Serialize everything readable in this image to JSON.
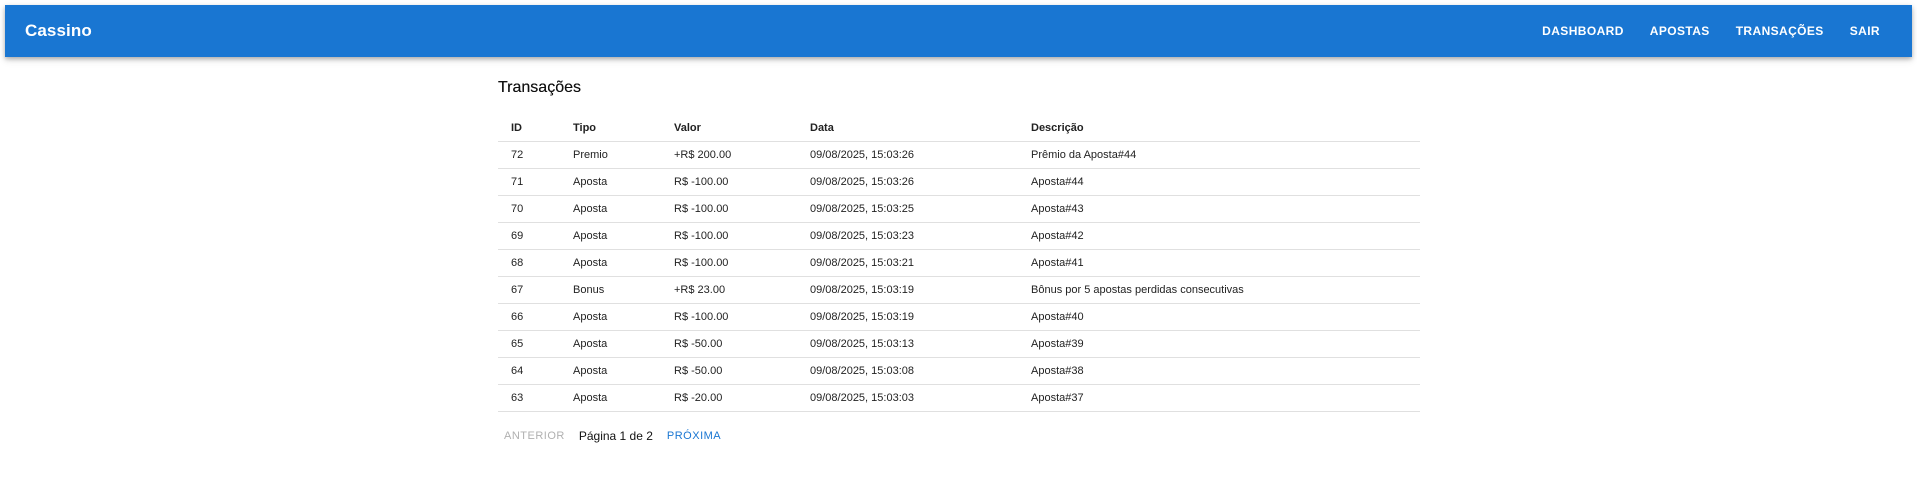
{
  "header": {
    "brand": "Cassino",
    "nav": [
      {
        "label": "DASHBOARD"
      },
      {
        "label": "APOSTAS"
      },
      {
        "label": "TRANSAÇÕES"
      },
      {
        "label": "SAIR"
      }
    ]
  },
  "page": {
    "title": "Transações"
  },
  "table": {
    "columns": [
      "ID",
      "Tipo",
      "Valor",
      "Data",
      "Descrição"
    ],
    "rows": [
      {
        "id": "72",
        "tipo": "Premio",
        "valor": "+R$ 200.00",
        "sign": "positive",
        "data": "09/08/2025, 15:03:26",
        "descricao": "Prêmio da Aposta#44"
      },
      {
        "id": "71",
        "tipo": "Aposta",
        "valor": "R$ -100.00",
        "sign": "negative",
        "data": "09/08/2025, 15:03:26",
        "descricao": "Aposta#44"
      },
      {
        "id": "70",
        "tipo": "Aposta",
        "valor": "R$ -100.00",
        "sign": "negative",
        "data": "09/08/2025, 15:03:25",
        "descricao": "Aposta#43"
      },
      {
        "id": "69",
        "tipo": "Aposta",
        "valor": "R$ -100.00",
        "sign": "negative",
        "data": "09/08/2025, 15:03:23",
        "descricao": "Aposta#42"
      },
      {
        "id": "68",
        "tipo": "Aposta",
        "valor": "R$ -100.00",
        "sign": "negative",
        "data": "09/08/2025, 15:03:21",
        "descricao": "Aposta#41"
      },
      {
        "id": "67",
        "tipo": "Bonus",
        "valor": "+R$ 23.00",
        "sign": "positive",
        "data": "09/08/2025, 15:03:19",
        "descricao": "Bônus por 5 apostas perdidas consecutivas"
      },
      {
        "id": "66",
        "tipo": "Aposta",
        "valor": "R$ -100.00",
        "sign": "negative",
        "data": "09/08/2025, 15:03:19",
        "descricao": "Aposta#40"
      },
      {
        "id": "65",
        "tipo": "Aposta",
        "valor": "R$ -50.00",
        "sign": "negative",
        "data": "09/08/2025, 15:03:13",
        "descricao": "Aposta#39"
      },
      {
        "id": "64",
        "tipo": "Aposta",
        "valor": "R$ -50.00",
        "sign": "negative",
        "data": "09/08/2025, 15:03:08",
        "descricao": "Aposta#38"
      },
      {
        "id": "63",
        "tipo": "Aposta",
        "valor": "R$ -20.00",
        "sign": "negative",
        "data": "09/08/2025, 15:03:03",
        "descricao": "Aposta#37"
      }
    ]
  },
  "pagination": {
    "prev_label": "ANTERIOR",
    "prev_disabled": true,
    "info": "Página 1 de 2",
    "next_label": "PRÓXIMA",
    "next_disabled": false
  },
  "colors": {
    "appbar": "#1976d2",
    "positive": "#2e7d32",
    "negative": "#c62828",
    "link": "#1976d2",
    "disabled": "#b0b0b0"
  }
}
